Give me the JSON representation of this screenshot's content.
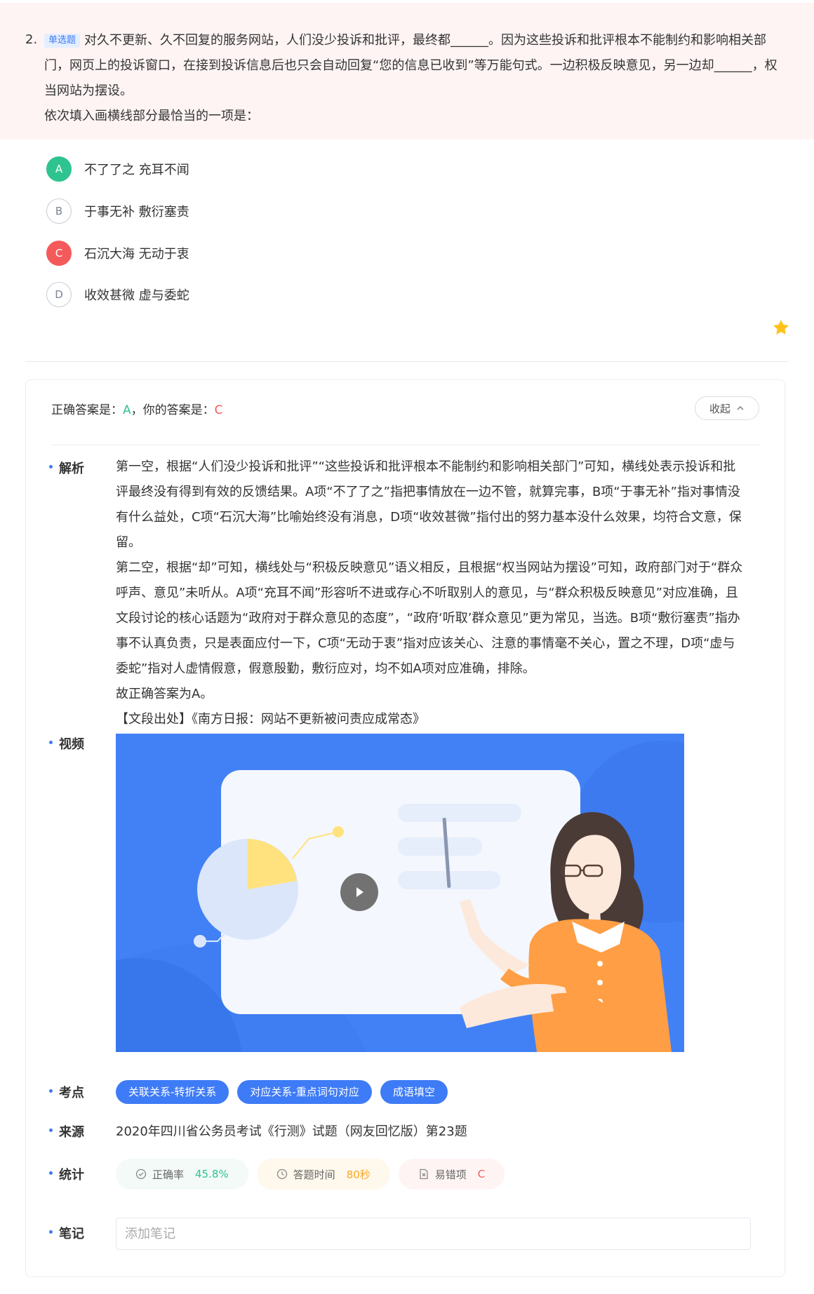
{
  "question": {
    "number": "2.",
    "type_tag": "单选题",
    "text": "对久不更新、久不回复的服务网站，人们没少投诉和批评，最终都______。因为这些投诉和批评根本不能制约和影响相关部门，网页上的投诉窗口，在接到投诉信息后也只会自动回复“您的信息已收到”等万能句式。一边积极反映意见，另一边却______，权当网站为摆设。",
    "prompt": "依次填入画横线部分最恰当的一项是："
  },
  "options": [
    {
      "letter": "A",
      "text": "不了了之 充耳不闻",
      "state": "correct"
    },
    {
      "letter": "B",
      "text": "于事无补 敷衍塞责",
      "state": "normal"
    },
    {
      "letter": "C",
      "text": "石沉大海 无动于衷",
      "state": "wrong"
    },
    {
      "letter": "D",
      "text": "收效甚微 虚与委蛇",
      "state": "normal"
    }
  ],
  "answer": {
    "correct_label": "正确答案是：",
    "correct_value": "A",
    "sep": "，",
    "yours_label": "你的答案是：",
    "yours_value": "C",
    "collapse_label": "收起"
  },
  "sections": {
    "analysis_label": "解析",
    "video_label": "视频",
    "points_label": "考点",
    "source_label": "来源",
    "stats_label": "统计",
    "notes_label": "笔记"
  },
  "analysis": [
    "第一空，根据“人们没少投诉和批评”“这些投诉和批评根本不能制约和影响相关部门”可知，横线处表示投诉和批评最终没有得到有效的反馈结果。A项“不了了之”指把事情放在一边不管，就算完事，B项“于事无补”指对事情没有什么益处，C项“石沉大海”比喻始终没有消息，D项“收效甚微”指付出的努力基本没什么效果，均符合文意，保留。",
    "第二空，根据“却”可知，横线处与“积极反映意见”语义相反，且根据“权当网站为摆设”可知，政府部门对于“群众呼声、意见”未听从。A项“充耳不闻”形容听不进或存心不听取别人的意见，与“群众积极反映意见”对应准确，且文段讨论的核心话题为“政府对于群众意见的态度”，“政府‘听取’群众意见”更为常见，当选。B项“敷衍塞责”指办事不认真负责，只是表面应付一下，C项“无动于衷”指对应该关心、注意的事情毫不关心，置之不理，D项“虚与委蛇”指对人虚情假意，假意殷勤，敷衍应对，均不如A项对应准确，排除。",
    "故正确答案为A。",
    "【文段出处】《南方日报：网站不更新被问责应成常态》"
  ],
  "points": [
    "关联关系-转折关系",
    "对应关系-重点词句对应",
    "成语填空"
  ],
  "source": "2020年四川省公务员考试《行测》试题（网友回忆版）第23题",
  "stats": {
    "accuracy_label": "正确率",
    "accuracy_value": "45.8%",
    "time_label": "答题时间",
    "time_value": "80秒",
    "mistake_label": "易错项",
    "mistake_value": "C"
  },
  "notes": {
    "placeholder": "添加笔记"
  },
  "colors": {
    "accent": "#3e7bf6",
    "correct": "#2fc38f",
    "wrong": "#f55a5a",
    "warning": "#f5a623",
    "question_bg": "#fff4f4"
  }
}
